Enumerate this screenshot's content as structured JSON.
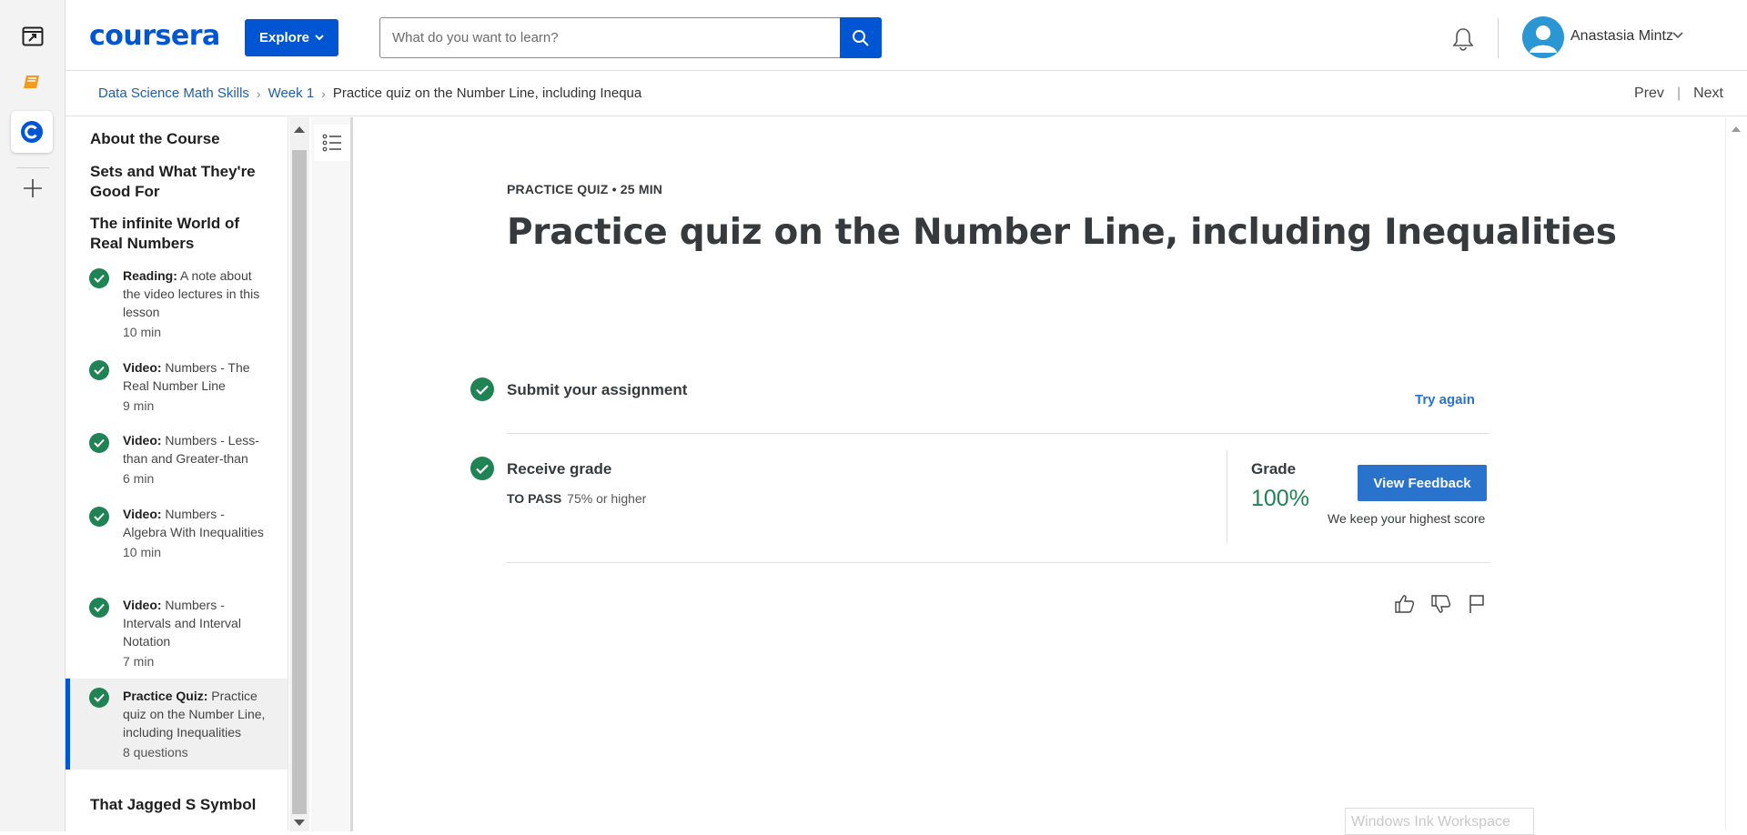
{
  "rail": {
    "icons": [
      "app-window-icon",
      "book-icon",
      "coursera-c-icon",
      "plus-icon"
    ]
  },
  "header": {
    "logo": "coursera",
    "explore_label": "Explore",
    "search_placeholder": "What do you want to learn?",
    "user_name": "Anastasia Mintz"
  },
  "breadcrumb": {
    "course": "Data Science Math Skills",
    "week": "Week 1",
    "current": "Practice quiz on the Number Line, including Inequaliti"
  },
  "nav": {
    "prev": "Prev",
    "divider": "|",
    "next": "Next"
  },
  "outline": {
    "sections": [
      "About the Course",
      "Sets and What They're Good For",
      "The infinite World of Real Numbers",
      "That Jagged S Symbol"
    ],
    "items": [
      {
        "type": "Reading:",
        "title": "A note about the video lectures in this lesson",
        "duration": "10 min"
      },
      {
        "type": "Video:",
        "title": "Numbers - The Real Number Line",
        "duration": "9 min"
      },
      {
        "type": "Video:",
        "title": "Numbers - Less-than and Greater-than",
        "duration": "6 min"
      },
      {
        "type": "Video:",
        "title": "Numbers - Algebra With Inequalities",
        "duration": "10 min"
      },
      {
        "type": "Video:",
        "title": "Numbers - Intervals and Interval Notation",
        "duration": "7 min"
      },
      {
        "type": "Practice Quiz:",
        "title": "Practice quiz on the Number Line, including Inequalities",
        "duration": "8 questions"
      }
    ]
  },
  "main": {
    "kicker": "PRACTICE QUIZ • 25 MIN",
    "title": "Practice quiz on the Number Line, including Inequalities",
    "submit_title": "Submit your assignment",
    "try_again": "Try again",
    "receive_title": "Receive grade",
    "to_pass_label": "TO PASS",
    "to_pass_value": "75% or higher",
    "grade_label": "Grade",
    "grade_value": "100%",
    "view_feedback": "View Feedback",
    "keep_note": "We keep your highest score"
  },
  "overlay": {
    "ink_workspace": "Windows Ink Workspace"
  },
  "colors": {
    "brand": "#0056d2",
    "success": "#1f8354",
    "link": "#2a73cc"
  }
}
